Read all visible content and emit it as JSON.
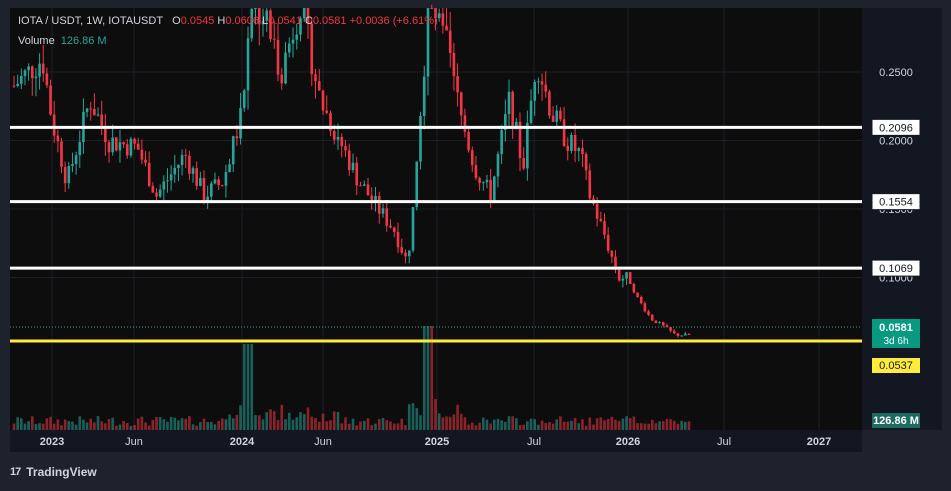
{
  "legend": {
    "symbol": "IOTA / USDT, 1W, IOTAUSDT",
    "open_key": "O",
    "open": "0.0545",
    "high_key": "H",
    "high": "0.0606",
    "low_key": "L",
    "low": "0.0541",
    "close_key": "C",
    "close": "0.0581",
    "change": "+0.0036 (+6.61%)",
    "volume_label": "Volume",
    "volume_value": "126.86 M"
  },
  "footer": {
    "brand": "TradingView",
    "logo_glyph": "17"
  },
  "colors": {
    "up": "#26a69a",
    "down": "#f23645",
    "level_line": "#ffffff",
    "support_line": "#ffeb3b",
    "pane_bg": "#0d0d0d",
    "chrome_bg": "#1e222d"
  },
  "chart_data": {
    "type": "candlestick",
    "x_ticks": [
      "2023",
      "Jun",
      "2024",
      "Jun",
      "2025",
      "Jul",
      "2026",
      "Jul",
      "2027"
    ],
    "y_ticks": [
      "0.2500",
      "0.2000",
      "0.1500",
      "0.1000"
    ],
    "y_range": [
      0.03,
      0.295
    ],
    "levels": [
      {
        "label": "0.2096",
        "value": 0.2096,
        "color": "#ffffff"
      },
      {
        "label": "0.1554",
        "value": 0.1554,
        "color": "#ffffff"
      },
      {
        "label": "0.1069",
        "value": 0.1069,
        "color": "#ffffff"
      },
      {
        "label": "0.0537",
        "value": 0.0537,
        "color": "#ffeb3b"
      }
    ],
    "last_price": {
      "label": "0.0581",
      "countdown": "3d 6h",
      "value": 0.0581
    },
    "volume_badge": "126.86 M",
    "price_path": [
      [
        2022.8,
        0.24
      ],
      [
        2022.95,
        0.26
      ],
      [
        2023.0,
        0.215
      ],
      [
        2023.08,
        0.17
      ],
      [
        2023.2,
        0.23
      ],
      [
        2023.3,
        0.2
      ],
      [
        2023.45,
        0.195
      ],
      [
        2023.55,
        0.16
      ],
      [
        2023.7,
        0.19
      ],
      [
        2023.8,
        0.16
      ],
      [
        2023.9,
        0.17
      ],
      [
        2024.0,
        0.22
      ],
      [
        2024.05,
        0.3
      ],
      [
        2024.12,
        0.29
      ],
      [
        2024.2,
        0.25
      ],
      [
        2024.3,
        0.3
      ],
      [
        2024.4,
        0.23
      ],
      [
        2024.5,
        0.2
      ],
      [
        2024.6,
        0.17
      ],
      [
        2024.7,
        0.15
      ],
      [
        2024.78,
        0.135
      ],
      [
        2024.85,
        0.11
      ],
      [
        2024.9,
        0.2
      ],
      [
        2024.96,
        0.3
      ],
      [
        2025.05,
        0.27
      ],
      [
        2025.12,
        0.22
      ],
      [
        2025.2,
        0.18
      ],
      [
        2025.28,
        0.16
      ],
      [
        2025.38,
        0.23
      ],
      [
        2025.45,
        0.18
      ],
      [
        2025.52,
        0.26
      ],
      [
        2025.6,
        0.22
      ],
      [
        2025.68,
        0.2
      ],
      [
        2025.75,
        0.19
      ],
      [
        2025.8,
        0.16
      ],
      [
        2025.88,
        0.13
      ],
      [
        2025.95,
        0.1
      ],
      [
        2026.0,
        0.1
      ],
      [
        2026.05,
        0.085
      ],
      [
        2026.12,
        0.07
      ],
      [
        2026.18,
        0.065
      ],
      [
        2026.25,
        0.058
      ],
      [
        2026.32,
        0.0581
      ]
    ]
  }
}
